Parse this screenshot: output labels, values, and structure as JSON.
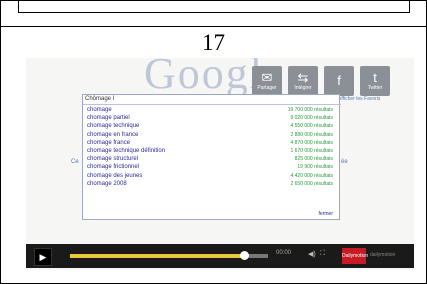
{
  "page_number": "17",
  "video": {
    "background_logo": "Google",
    "share_buttons": [
      {
        "icon": "share-icon",
        "glyph": "✉",
        "label": "Partager"
      },
      {
        "icon": "embed-icon",
        "glyph": "⇆",
        "label": "Intégrer"
      },
      {
        "icon": "facebook-icon",
        "glyph": "f",
        "label": ""
      },
      {
        "icon": "twitter-icon",
        "glyph": "t",
        "label": "Twitter"
      }
    ],
    "side_link": "Afficher les Favoris",
    "left_fragment": "Ce",
    "right_fragment": "ée",
    "search_query": "Chômage I",
    "suggestions": [
      {
        "term": "chomage",
        "count": "19 700 000 résultats"
      },
      {
        "term": "chomage partiel",
        "count": "9 020 000 résultats"
      },
      {
        "term": "chomage technique",
        "count": "4 550 000 résultats"
      },
      {
        "term": "chomage en france",
        "count": "2 880 000 résultats"
      },
      {
        "term": "chomage france",
        "count": "4 870 000 résultats"
      },
      {
        "term": "chomage technique définition",
        "count": "1 670 000 résultats"
      },
      {
        "term": "chomage structurel",
        "count": "825 000 résultats"
      },
      {
        "term": "chomage frictionnel",
        "count": "19 900 résultats"
      },
      {
        "term": "chomage des jeunes",
        "count": "4 420 000 résultats"
      },
      {
        "term": "chomage 2008",
        "count": "2 650 000 résultats"
      }
    ],
    "close_label": "fermer"
  },
  "player": {
    "progress": 0.88,
    "time": "00:00",
    "play_glyph": "▶",
    "volume_glyph": "◀)",
    "fullscreen_glyph": "⛶",
    "brand_badge": "Dailymotion",
    "brand_text": "dailymotion"
  }
}
